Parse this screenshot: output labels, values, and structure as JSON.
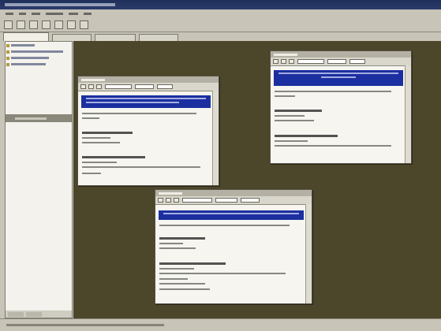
{
  "app": {
    "window_title": ""
  },
  "menu": [
    {
      "label": ""
    },
    {
      "label": ""
    },
    {
      "label": ""
    },
    {
      "label": ""
    },
    {
      "label": ""
    },
    {
      "label": ""
    }
  ],
  "tabs": [
    {
      "label": "",
      "active": true
    },
    {
      "label": "",
      "active": false
    },
    {
      "label": "",
      "active": false
    },
    {
      "label": "",
      "active": false
    }
  ],
  "tree": {
    "items": [
      {
        "label": ""
      },
      {
        "label": ""
      },
      {
        "label": ""
      },
      {
        "label": ""
      }
    ]
  },
  "child_windows": [
    {
      "title": "",
      "selected_line": ""
    },
    {
      "title": "",
      "selected_line": ""
    },
    {
      "title": "",
      "selected_line": ""
    }
  ],
  "status": {
    "text": ""
  },
  "colors": {
    "accent": "#e07a28",
    "workspace": "#4c462a",
    "titlebar": "#1f2f5a",
    "selection": "#1c2fa0"
  },
  "icons": [
    "new-icon",
    "open-icon",
    "save-icon",
    "cut-icon",
    "alert-icon",
    "connect-icon",
    "help-icon"
  ]
}
